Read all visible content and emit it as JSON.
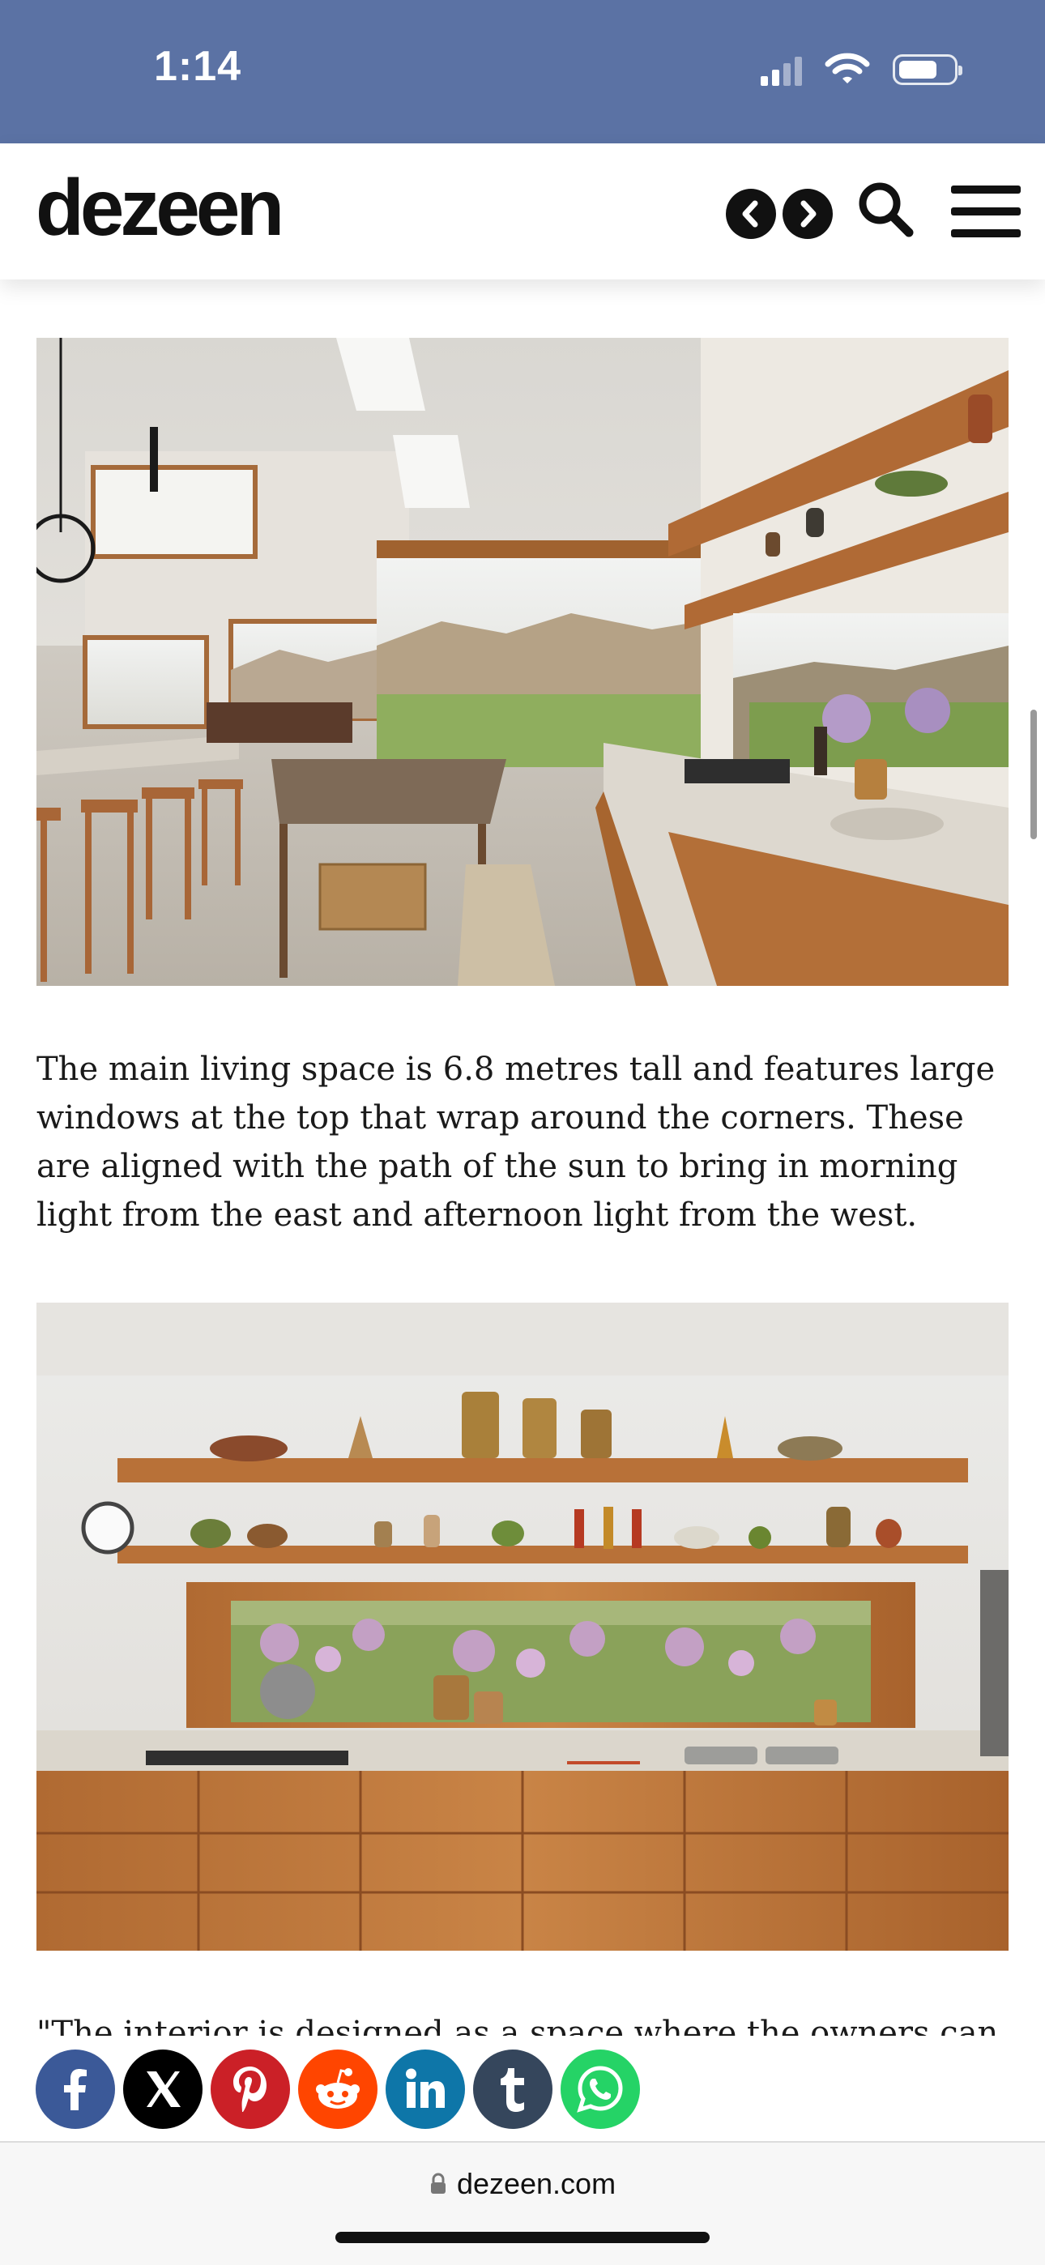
{
  "status_bar": {
    "time": "1:14"
  },
  "header": {
    "logo": "dezeen",
    "prev_icon": "chevron-left-icon",
    "next_icon": "chevron-right-icon",
    "search_icon": "search-icon",
    "menu_icon": "hamburger-menu-icon"
  },
  "article": {
    "paragraph_1": "The main living space is 6.8 metres tall and features large windows at the top that wrap around the corners. These are aligned with the path of the sun to bring in morning light from the east and afternoon light from the west.",
    "paragraph_2_partial": "\"The interior is designed as a space where the owners can"
  },
  "share": {
    "items": [
      {
        "name": "facebook",
        "color": "#3b5998"
      },
      {
        "name": "x",
        "color": "#000000"
      },
      {
        "name": "pinterest",
        "color": "#cb2027"
      },
      {
        "name": "reddit",
        "color": "#ff4500"
      },
      {
        "name": "linkedin",
        "color": "#0e76a8"
      },
      {
        "name": "tumblr",
        "color": "#35465c"
      },
      {
        "name": "whatsapp",
        "color": "#25d366"
      }
    ]
  },
  "browser": {
    "url": "dezeen.com"
  },
  "colors": {
    "status_bar": "#5b72a4"
  }
}
